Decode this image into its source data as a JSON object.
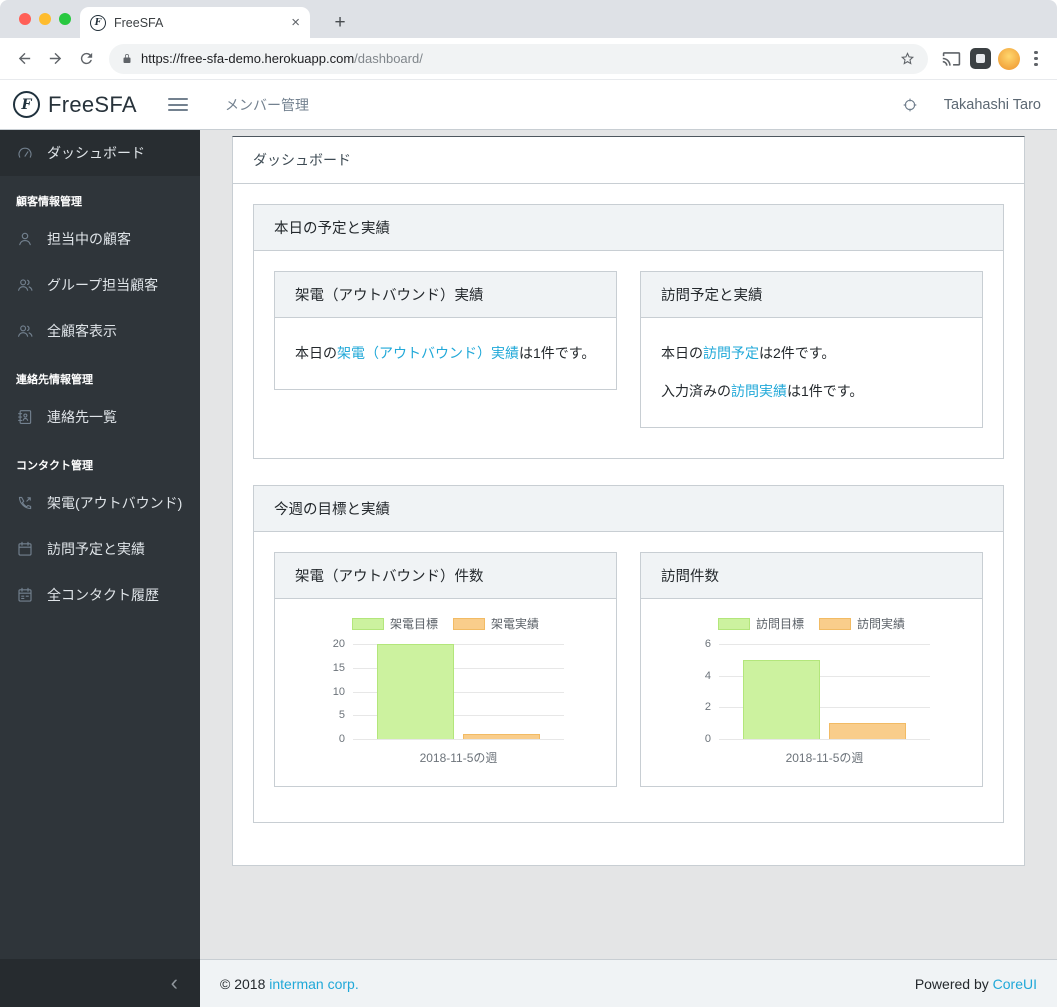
{
  "browser": {
    "tab_title": "FreeSFA",
    "url_base": "https://free-sfa-demo.herokuapp.com",
    "url_path": "/dashboard/"
  },
  "icons": {
    "tab_close": "×",
    "new_tab": "+",
    "minimizer": "‹"
  },
  "app_header": {
    "brand": "FreeSFA",
    "brand_initial": "F",
    "member_link": "メンバー管理",
    "user_name": "Takahashi Taro"
  },
  "sidebar": {
    "dashboard": "ダッシュボード",
    "sections": {
      "customer": "顧客情報管理",
      "contact_info": "連絡先情報管理",
      "contact_mgmt": "コンタクト管理"
    },
    "items": {
      "my_customers": "担当中の顧客",
      "group_customers": "グループ担当顧客",
      "all_customers": "全顧客表示",
      "contact_list": "連絡先一覧",
      "outbound_calls": "架電(アウトバウンド)",
      "visits": "訪問予定と実績",
      "all_contact_history": "全コンタクト履歴"
    }
  },
  "breadcrumb": {
    "title": "ダッシュボード"
  },
  "today": {
    "card_title": "本日の予定と実績",
    "calls": {
      "title": "架電（アウトバウンド）実績",
      "prefix": "本日の",
      "link": "架電（アウトバウンド）実績",
      "suffix": "は1件です。"
    },
    "visits": {
      "title": "訪問予定と実績",
      "line1_prefix": "本日の",
      "line1_link": "訪問予定",
      "line1_suffix": "は2件です。",
      "line2_prefix": "入力済みの",
      "line2_link": "訪問実績",
      "line2_suffix": "は1件です。"
    }
  },
  "week": {
    "card_title": "今週の目標と実績",
    "calls_chart_title": "架電（アウトバウンド）件数",
    "visits_chart_title": "訪問件数"
  },
  "chart_data": [
    {
      "type": "bar",
      "title": "架電（アウトバウンド）件数",
      "categories": [
        "2018-11-5の週"
      ],
      "series": [
        {
          "name": "架電目標",
          "values": [
            20
          ],
          "fill": "#ccf29f",
          "border": "#b3e67b"
        },
        {
          "name": "架電実績",
          "values": [
            1
          ],
          "fill": "#f9cd8b",
          "border": "#f2bb64"
        }
      ],
      "ylim": [
        0,
        20
      ],
      "yticks": [
        0,
        5,
        10,
        15,
        20
      ],
      "legend_position": "top",
      "grid": true,
      "xlabel": "",
      "ylabel": ""
    },
    {
      "type": "bar",
      "title": "訪問件数",
      "categories": [
        "2018-11-5の週"
      ],
      "series": [
        {
          "name": "訪問目標",
          "values": [
            5
          ],
          "fill": "#ccf29f",
          "border": "#b3e67b"
        },
        {
          "name": "訪問実績",
          "values": [
            1
          ],
          "fill": "#f9cd8b",
          "border": "#f2bb64"
        }
      ],
      "ylim": [
        0,
        6
      ],
      "yticks": [
        0,
        2,
        4,
        6
      ],
      "legend_position": "top",
      "grid": true,
      "xlabel": "",
      "ylabel": ""
    }
  ],
  "colors": {
    "link": "#20a8d8",
    "sidebar_bg": "#2f353a",
    "goal_green": "#ccf29f",
    "actual_orange": "#f9cd8b"
  },
  "footer": {
    "copyright_prefix": "© 2018 ",
    "copyright_link": "interman corp.",
    "powered_prefix": "Powered by ",
    "powered_link": "CoreUI"
  }
}
